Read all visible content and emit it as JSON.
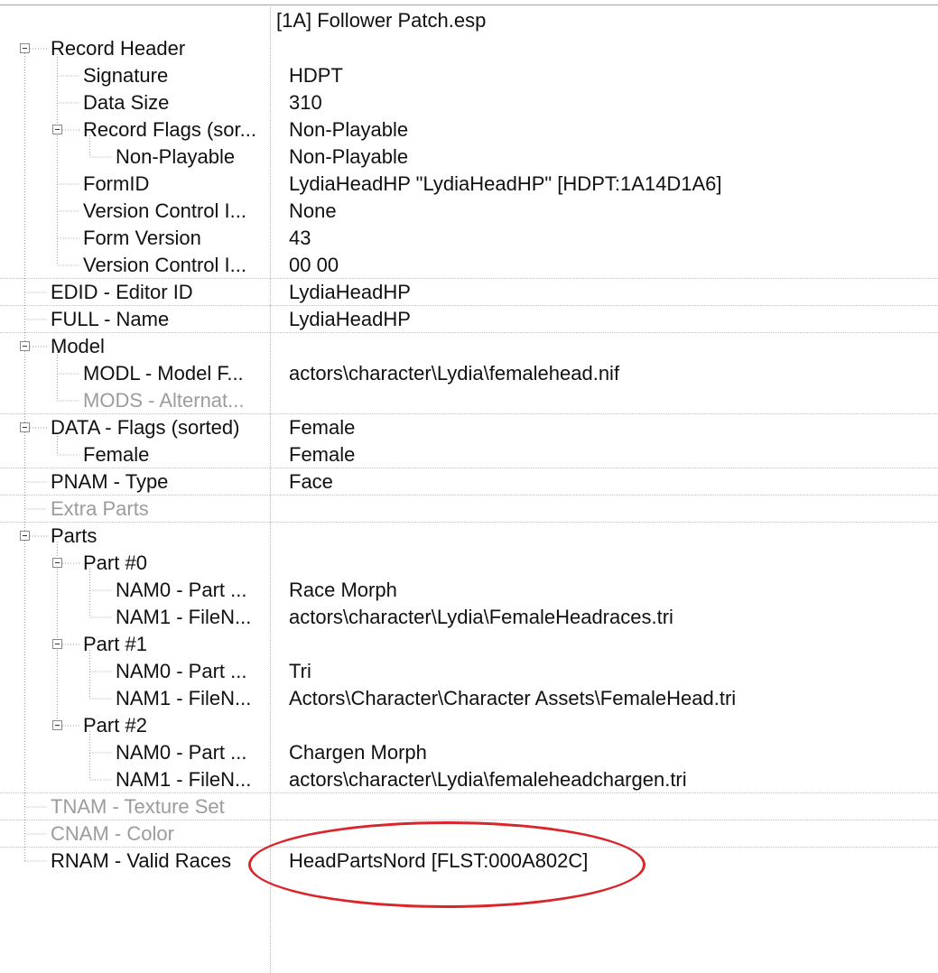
{
  "header": {
    "file": "[1A] Follower Patch.esp"
  },
  "rows": [
    {
      "name": "Record Header",
      "value": ""
    },
    {
      "name": "Signature",
      "value": "HDPT"
    },
    {
      "name": "Data Size",
      "value": "310"
    },
    {
      "name": "Record Flags (sor...",
      "value": "Non-Playable"
    },
    {
      "name": "Non-Playable",
      "value": "Non-Playable"
    },
    {
      "name": "FormID",
      "value": "LydiaHeadHP \"LydiaHeadHP\" [HDPT:1A14D1A6]"
    },
    {
      "name": "Version Control I...",
      "value": "None"
    },
    {
      "name": "Form Version",
      "value": "43"
    },
    {
      "name": "Version Control I...",
      "value": "00 00"
    },
    {
      "name": "EDID - Editor ID",
      "value": "LydiaHeadHP"
    },
    {
      "name": "FULL - Name",
      "value": "LydiaHeadHP"
    },
    {
      "name": "Model",
      "value": ""
    },
    {
      "name": "MODL - Model F...",
      "value": "actors\\character\\Lydia\\femalehead.nif"
    },
    {
      "name": "MODS - Alternat...",
      "value": ""
    },
    {
      "name": "DATA - Flags (sorted)",
      "value": "Female"
    },
    {
      "name": "Female",
      "value": "Female"
    },
    {
      "name": "PNAM - Type",
      "value": "Face"
    },
    {
      "name": "Extra Parts",
      "value": ""
    },
    {
      "name": "Parts",
      "value": ""
    },
    {
      "name": "Part #0",
      "value": ""
    },
    {
      "name": "NAM0 - Part ...",
      "value": "Race Morph"
    },
    {
      "name": "NAM1 - FileN...",
      "value": "actors\\character\\Lydia\\FemaleHeadraces.tri"
    },
    {
      "name": "Part #1",
      "value": ""
    },
    {
      "name": "NAM0 - Part ...",
      "value": "Tri"
    },
    {
      "name": "NAM1 - FileN...",
      "value": "Actors\\Character\\Character Assets\\FemaleHead.tri"
    },
    {
      "name": "Part #2",
      "value": ""
    },
    {
      "name": "NAM0 - Part ...",
      "value": "Chargen Morph"
    },
    {
      "name": "NAM1 - FileN...",
      "value": "actors\\character\\Lydia\\femaleheadchargen.tri"
    },
    {
      "name": "TNAM - Texture Set",
      "value": ""
    },
    {
      "name": "CNAM - Color",
      "value": ""
    },
    {
      "name": "RNAM - Valid Races",
      "value": "HeadPartsNord [FLST:000A802C]"
    }
  ]
}
